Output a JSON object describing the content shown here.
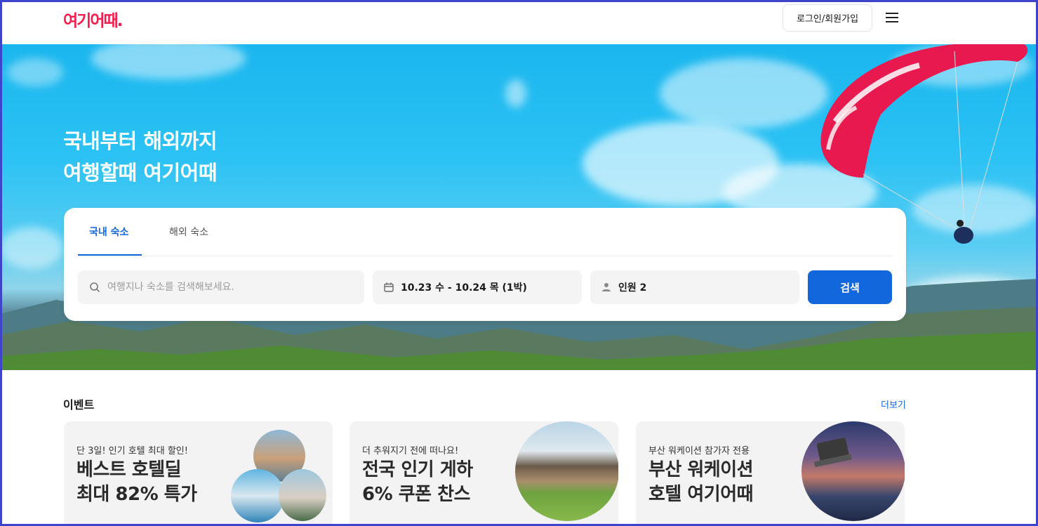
{
  "header": {
    "logo": "여기어때.",
    "login_label": "로그인/회원가입"
  },
  "hero": {
    "title_line1": "국내부터 해외까지",
    "title_line2": "여행할때 여기어때"
  },
  "search": {
    "tabs": [
      {
        "label": "국내 숙소",
        "active": true
      },
      {
        "label": "해외 숙소",
        "active": false
      }
    ],
    "placeholder": "여행지나 숙소를 검색해보세요.",
    "dates": "10.23 수 - 10.24 목 (1박)",
    "guests": "인원 2",
    "button_label": "검색"
  },
  "events": {
    "title": "이벤트",
    "more_label": "더보기",
    "cards": [
      {
        "subtitle": "단 3일! 인기 호텔 최대 할인!",
        "headline_line1": "베스트 호텔딜",
        "headline_line2": "최대 82% 특가"
      },
      {
        "subtitle": "더 추워지기 전에 떠나요!",
        "headline_line1": "전국 인기 게하",
        "headline_line2": "6% 쿠폰 찬스"
      },
      {
        "subtitle": "부산 워케이션 참가자 전용",
        "headline_line1": "부산 워케이션",
        "headline_line2": "호텔 여기어때"
      }
    ]
  },
  "colors": {
    "brand": "#f51f4f",
    "accent": "#1267dd",
    "frame": "#3d44c9"
  }
}
